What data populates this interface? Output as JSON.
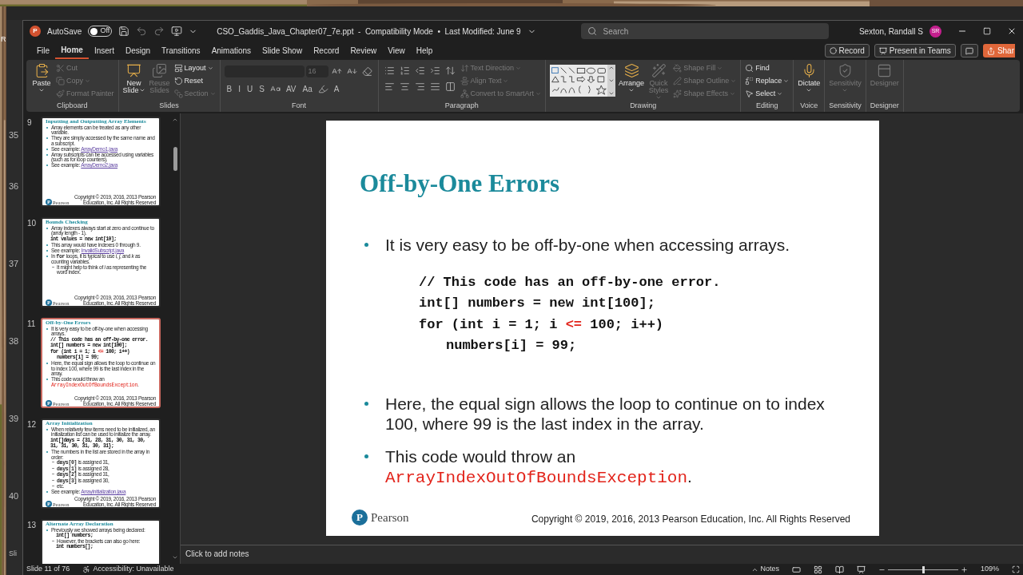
{
  "desktop": {
    "fragment": "R"
  },
  "back_window": {
    "slide_numbers": [
      "35",
      "36",
      "37",
      "38",
      "39",
      "40"
    ],
    "status_fragment": "Sli"
  },
  "window": {
    "app_logo": "P",
    "autosave": {
      "label": "AutoSave",
      "state": "Off",
      "on": false
    },
    "title": "CSO_Gaddis_Java_Chapter07_7e.ppt  -  Compatibility Mode  •  Last Modified: June 9",
    "search": {
      "placeholder": "Search"
    },
    "user": {
      "name": "Sexton, Randall S",
      "initials": "SR"
    }
  },
  "tabs": [
    {
      "label": "File",
      "selected": false
    },
    {
      "label": "Home",
      "selected": true
    },
    {
      "label": "Insert",
      "selected": false
    },
    {
      "label": "Design",
      "selected": false
    },
    {
      "label": "Transitions",
      "selected": false
    },
    {
      "label": "Animations",
      "selected": false
    },
    {
      "label": "Slide Show",
      "selected": false
    },
    {
      "label": "Record",
      "selected": false
    },
    {
      "label": "Review",
      "selected": false
    },
    {
      "label": "View",
      "selected": false
    },
    {
      "label": "Help",
      "selected": false
    }
  ],
  "actions": [
    {
      "kind": "record",
      "label": "Record"
    },
    {
      "kind": "teams",
      "label": "Present in Teams"
    },
    {
      "kind": "comment"
    },
    {
      "kind": "share",
      "label": "Shar"
    }
  ],
  "ribbon": [
    {
      "label": "Clipboard",
      "columns": [
        {
          "kind": "stack",
          "items": [
            {
              "kind": "large",
              "label": "Paste",
              "menu": true,
              "disabled": false
            }
          ]
        },
        {
          "kind": "stack",
          "items": [
            {
              "kind": "small",
              "label": "Cut",
              "menu": false,
              "disabled": true
            },
            {
              "kind": "small",
              "label": "Copy",
              "menu": true,
              "disabled": true
            },
            {
              "kind": "small",
              "label": "Format Painter",
              "menu": false,
              "disabled": true
            }
          ]
        }
      ]
    },
    {
      "label": "Slides",
      "columns": [
        {
          "kind": "stack",
          "items": [
            {
              "kind": "large",
              "label": "New Slide",
              "menu": true,
              "disabled": false
            }
          ]
        },
        {
          "kind": "stack",
          "items": [
            {
              "kind": "large",
              "label": "Reuse Slides",
              "menu": false,
              "disabled": true
            }
          ]
        },
        {
          "kind": "stack",
          "items": [
            {
              "kind": "small",
              "label": "Layout",
              "menu": true,
              "disabled": false
            },
            {
              "kind": "small",
              "label": "Reset",
              "menu": false,
              "disabled": false
            },
            {
              "kind": "small",
              "label": "Section",
              "menu": true,
              "disabled": true
            }
          ]
        }
      ]
    },
    {
      "label": "Font",
      "columns": [
        {
          "kind": "lines",
          "lines": [
            {
              "items": [
                {
                  "kind": "font-name"
                },
                {
                  "kind": "font-size",
                  "value": "16"
                },
                {
                  "kind": "icon"
                },
                {
                  "kind": "icon"
                },
                {
                  "kind": "icon"
                }
              ]
            },
            {
              "items": [
                {
                  "kind": "letter",
                  "text": "B"
                },
                {
                  "kind": "letter",
                  "text": "I"
                },
                {
                  "kind": "letter",
                  "text": "U"
                },
                {
                  "kind": "letter",
                  "text": "S"
                },
                {
                  "kind": "icon"
                },
                {
                  "kind": "letter",
                  "text": "AV"
                },
                {
                  "kind": "letter",
                  "text": "Aa"
                },
                {
                  "kind": "icon"
                },
                {
                  "kind": "letter",
                  "text": "A"
                }
              ]
            }
          ]
        }
      ]
    },
    {
      "label": "Paragraph",
      "columns": [
        {
          "kind": "lines",
          "lines": [
            {
              "items": [
                {
                  "kind": "icon"
                },
                {
                  "kind": "icon"
                },
                {
                  "kind": "icon"
                },
                {
                  "kind": "icon"
                },
                {
                  "kind": "icon"
                }
              ]
            },
            {
              "items": [
                {
                  "kind": "icon"
                },
                {
                  "kind": "icon"
                },
                {
                  "kind": "icon"
                },
                {
                  "kind": "icon"
                },
                {
                  "kind": "icon"
                }
              ]
            }
          ]
        },
        {
          "kind": "stack",
          "items": [
            {
              "kind": "small",
              "label": "Text Direction",
              "menu": true,
              "disabled": true
            },
            {
              "kind": "small",
              "label": "Align Text",
              "menu": true,
              "disabled": true
            },
            {
              "kind": "small",
              "label": "Convert to SmartArt",
              "menu": true,
              "disabled": true
            }
          ]
        }
      ]
    },
    {
      "label": "Drawing",
      "columns": [
        {
          "kind": "stack",
          "items": [
            {
              "kind": "gallery"
            }
          ]
        },
        {
          "kind": "stack",
          "items": [
            {
              "kind": "large",
              "label": "Arrange",
              "menu": true,
              "disabled": false
            }
          ]
        },
        {
          "kind": "stack",
          "items": [
            {
              "kind": "large",
              "label": "Quick Styles",
              "menu": true,
              "disabled": true
            }
          ]
        },
        {
          "kind": "stack",
          "items": [
            {
              "kind": "small",
              "label": "Shape Fill",
              "menu": true,
              "disabled": true
            },
            {
              "kind": "small",
              "label": "Shape Outline",
              "menu": true,
              "disabled": true
            },
            {
              "kind": "small",
              "label": "Shape Effects",
              "menu": true,
              "disabled": true
            }
          ]
        }
      ]
    },
    {
      "label": "Editing",
      "columns": [
        {
          "kind": "stack",
          "items": [
            {
              "kind": "small",
              "label": "Find",
              "menu": false,
              "disabled": false
            },
            {
              "kind": "small",
              "label": "Replace",
              "menu": true,
              "disabled": false
            },
            {
              "kind": "small",
              "label": "Select",
              "menu": true,
              "disabled": false
            }
          ]
        }
      ]
    },
    {
      "label": "Voice",
      "columns": [
        {
          "kind": "stack",
          "items": [
            {
              "kind": "large",
              "label": "Dictate",
              "menu": true,
              "disabled": false
            }
          ]
        }
      ]
    },
    {
      "label": "Sensitivity",
      "columns": [
        {
          "kind": "stack",
          "items": [
            {
              "kind": "large",
              "label": "Sensitivity",
              "menu": true,
              "disabled": true
            }
          ]
        }
      ]
    },
    {
      "label": "Designer",
      "columns": [
        {
          "kind": "stack",
          "items": [
            {
              "kind": "large",
              "label": "Designer",
              "menu": false,
              "disabled": true
            }
          ]
        }
      ]
    }
  ],
  "thumbnails": [
    {
      "number": "9",
      "selected": false,
      "title": "Inputting and Outputting Array Elements",
      "items": [
        {
          "kind": "bullet",
          "text": "Array elements can be treated as any other variable."
        },
        {
          "kind": "bullet",
          "text": "They are simply accessed by the same name and a subscript."
        },
        {
          "kind": "bullet",
          "parts": [
            {
              "text": "See example: ",
              "kind": "plain"
            },
            {
              "text": "ArrayDemo1.java",
              "kind": "link"
            }
          ]
        },
        {
          "kind": "bullet",
          "text": "Array subscripts can be accessed using variables (such as for loop counters)."
        },
        {
          "kind": "bullet",
          "parts": [
            {
              "text": "See example: ",
              "kind": "plain"
            },
            {
              "text": "ArrayDemo2.java",
              "kind": "link"
            }
          ]
        }
      ],
      "footer": {
        "mark": "P",
        "brand": "Pearson",
        "copyright": "Copyright © 2019, 2016, 2013 Pearson Education, Inc. All Rights Reserved"
      }
    },
    {
      "number": "10",
      "selected": false,
      "title": "Bounds Checking",
      "items": [
        {
          "kind": "bullet",
          "text": "Array indexes always start at zero and continue to (array length - 1)."
        },
        {
          "kind": "code",
          "lines": [
            {
              "text": "int values = new int[10];"
            }
          ]
        },
        {
          "kind": "bullet",
          "text": "This array would have indexes 0 through 9."
        },
        {
          "kind": "bullet",
          "parts": [
            {
              "text": "See example: ",
              "kind": "plain"
            },
            {
              "text": "InvalidSubscript.java",
              "kind": "link"
            }
          ]
        },
        {
          "kind": "bullet",
          "parts": [
            {
              "text": "In ",
              "kind": "plain"
            },
            {
              "text": "for",
              "kind": "code"
            },
            {
              "text": " loops, it is typical to use *i*, *j*, and *k* as counting variables.",
              "kind": "plain"
            }
          ],
          "children": [
            {
              "kind": "bullet",
              "text": "It might help to think of *i* as representing the word index."
            }
          ]
        }
      ],
      "footer": {
        "mark": "P",
        "brand": "Pearson",
        "copyright": "Copyright © 2019, 2016, 2013 Pearson Education, Inc. All Rights Reserved"
      }
    },
    {
      "number": "11",
      "selected": true,
      "title": "Off-by-One Errors",
      "items": [
        {
          "kind": "bullet",
          "text": "It is very easy to be off-by-one when accessing arrays."
        },
        {
          "kind": "code",
          "lines": [
            {
              "text": "// This code has an off-by-one error."
            },
            {
              "text": "int[] numbers = new int[100];"
            },
            {
              "parts": [
                {
                  "text": "for (int i = 1; i ",
                  "kind": "plain"
                },
                {
                  "text": "<=",
                  "kind": "error"
                },
                {
                  "text": " 100; i++)",
                  "kind": "plain"
                }
              ],
              "children": [
                {
                  "text": "numbers[i] = 99;"
                }
              ]
            }
          ]
        },
        {
          "kind": "bullet",
          "text": "Here, the equal sign allows the loop to continue on to index 100, where 99 is the last index in the array."
        },
        {
          "kind": "bullet",
          "parts": [
            {
              "text": "This code would throw an ",
              "kind": "plain"
            },
            {
              "text": "ArrayIndexOutOfBoundsException",
              "kind": "code-error"
            },
            {
              "text": ".",
              "kind": "plain"
            }
          ]
        }
      ],
      "footer": {
        "mark": "P",
        "brand": "Pearson",
        "copyright": "Copyright © 2019, 2016, 2013 Pearson Education, Inc. All Rights Reserved"
      }
    },
    {
      "number": "12",
      "selected": false,
      "title": "Array Initialization",
      "items": [
        {
          "kind": "bullet",
          "text": "When relatively few items need to be initialized, an initialization list can be used to initialize the array."
        },
        {
          "kind": "code",
          "lines": [
            {
              "text": "int[]days = {31, 28, 31, 30, 31, 30, 31, 31, 30, 31, 30, 31};"
            }
          ]
        },
        {
          "kind": "bullet",
          "text": "The numbers in the list are stored in the array in order:",
          "children": [
            {
              "kind": "bullet",
              "parts": [
                {
                  "text": "days[0]",
                  "kind": "code"
                },
                {
                  "text": " is assigned 31,",
                  "kind": "plain"
                }
              ]
            },
            {
              "kind": "bullet",
              "parts": [
                {
                  "text": "days[1]",
                  "kind": "code"
                },
                {
                  "text": " is assigned 28,",
                  "kind": "plain"
                }
              ]
            },
            {
              "kind": "bullet",
              "parts": [
                {
                  "text": "days[2]",
                  "kind": "code"
                },
                {
                  "text": " is assigned 31,",
                  "kind": "plain"
                }
              ]
            },
            {
              "kind": "bullet",
              "parts": [
                {
                  "text": "days[3]",
                  "kind": "code"
                },
                {
                  "text": " is assigned 30,",
                  "kind": "plain"
                }
              ]
            },
            {
              "kind": "bullet",
              "text": "etc."
            }
          ]
        },
        {
          "kind": "bullet",
          "parts": [
            {
              "text": "See example: ",
              "kind": "plain"
            },
            {
              "text": "ArrayInitialization.java",
              "kind": "link"
            }
          ]
        }
      ],
      "footer": {
        "mark": "P",
        "brand": "Pearson",
        "copyright": "Copyright © 2019, 2016, 2013 Pearson Education, Inc. All Rights Reserved"
      }
    },
    {
      "number": "13",
      "selected": false,
      "title": "Alternate Array Declaration",
      "items": [
        {
          "kind": "bullet",
          "text": "Previously we showed arrays being declared:",
          "children": [
            {
              "kind": "code",
              "lines": [
                {
                  "text": "int[] numbers;"
                }
              ]
            },
            {
              "kind": "bullet",
              "text": "However, the brackets can also go here:"
            },
            {
              "kind": "code",
              "lines": [
                {
                  "text": "int numbers[];"
                }
              ]
            }
          ]
        }
      ]
    }
  ],
  "slide": {
    "title": "Off-by-One Errors",
    "items": [
      {
        "kind": "bullet",
        "text": "It is very easy to be off-by-one when accessing arrays."
      },
      {
        "kind": "code",
        "lines": [
          {
            "text": "// This code has an off-by-one error."
          },
          {
            "text": "int[] numbers = new int[100];"
          },
          {
            "parts": [
              {
                "text": "for (int i = 1; i ",
                "kind": "plain"
              },
              {
                "text": "<=",
                "kind": "error"
              },
              {
                "text": " 100; i++)",
                "kind": "plain"
              }
            ],
            "children": [
              {
                "text": "numbers[i] = 99;"
              }
            ]
          }
        ]
      },
      {
        "kind": "bullet",
        "text": "Here, the equal sign allows the loop to continue on to index 100, where 99 is the last index in the array."
      },
      {
        "kind": "bullet",
        "parts": [
          {
            "text": "This code would throw an ",
            "kind": "plain"
          },
          {
            "text": "ArrayIndexOutOfBoundsException",
            "kind": "code-error"
          },
          {
            "text": ".",
            "kind": "plain"
          }
        ]
      }
    ],
    "footer": {
      "mark": "P",
      "brand": "Pearson",
      "copyright": "Copyright © 2019, 2016, 2013 Pearson Education, Inc. All Rights Reserved"
    }
  },
  "notes": {
    "placeholder": "Click to add notes"
  },
  "status_bar": {
    "slide": "Slide 11 of 76",
    "accessibility": "Accessibility: Unavailable",
    "notes": "Notes",
    "zoom": {
      "level": 0.5,
      "reading": "109%"
    }
  }
}
